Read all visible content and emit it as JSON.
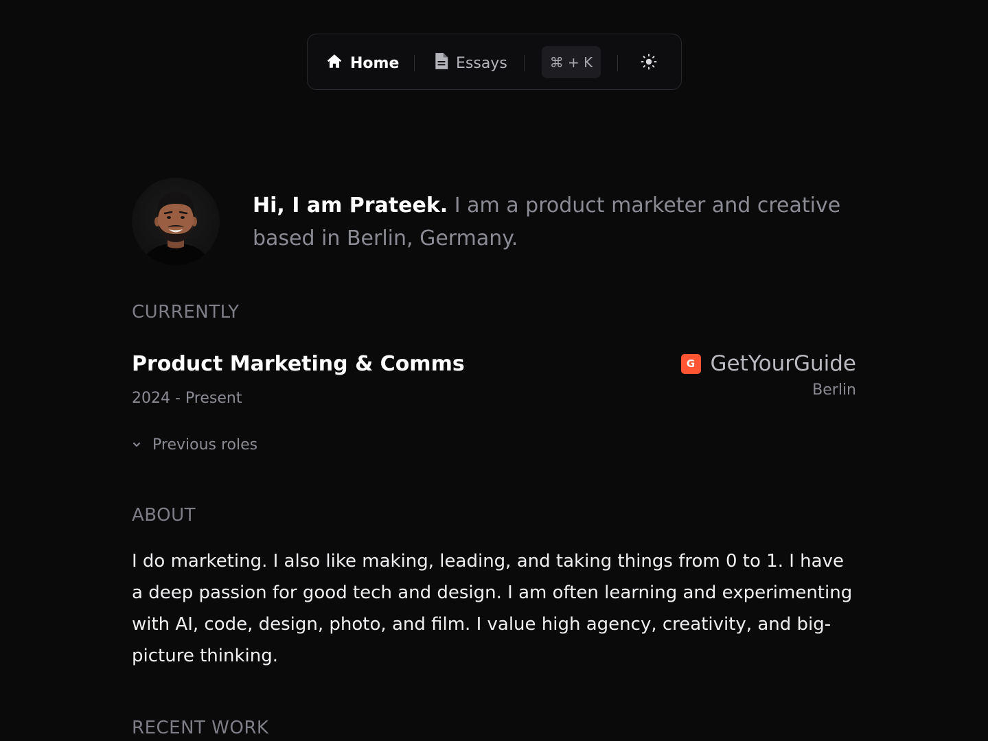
{
  "nav": {
    "home_label": "Home",
    "essays_label": "Essays",
    "command_shortcut": "⌘ + K",
    "home_icon": "home-icon",
    "essays_icon": "document-icon",
    "theme_icon": "sun-icon"
  },
  "hero": {
    "greeting": "Hi, I am Prateek.",
    "tagline": " I am a product marketer and creative based in Berlin, Germany."
  },
  "currently": {
    "label": "CURRENTLY",
    "role_title": "Product Marketing & Comms",
    "dates": "2024 - Present",
    "company": "GetYourGuide",
    "city": "Berlin",
    "logo_letter": "G",
    "logo_color": "#ff5533",
    "previous_roles_label": "Previous roles"
  },
  "about": {
    "label": "ABOUT",
    "text": "I do marketing. I also like making, leading, and taking things from 0 to 1. I have a deep passion for good tech and design. I am often learning and experimenting with AI, code, design, photo, and film. I value high agency, creativity, and big-picture thinking."
  },
  "recent_work": {
    "label": "RECENT WORK"
  },
  "colors": {
    "background": "#0a0a0b",
    "primary_text": "#ffffff",
    "muted_text": "#8a8b93",
    "accent": "#ff5533"
  }
}
